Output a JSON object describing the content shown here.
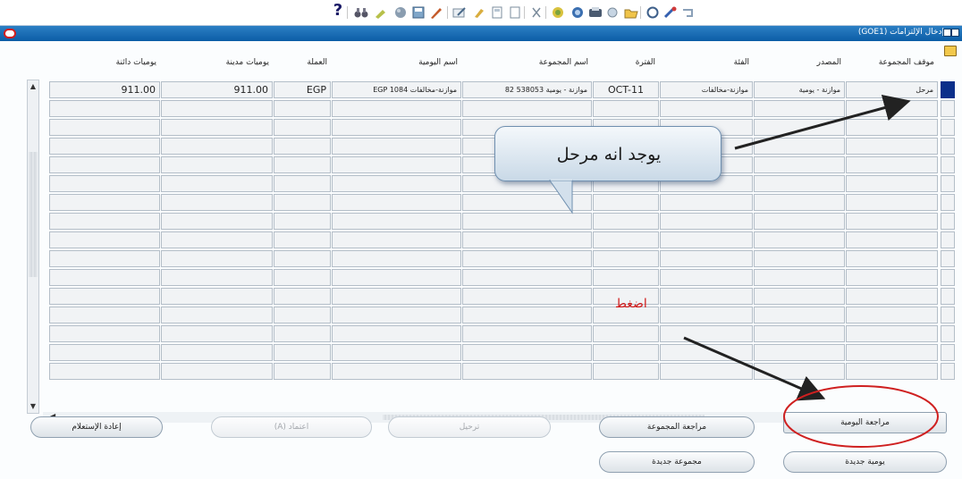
{
  "toolbar": {
    "help": "?",
    "icons": [
      "binoculars-icon",
      "flashlight-icon",
      "globe-icon",
      "save-icon",
      "pen-icon",
      "edit-icon",
      "attachment-icon",
      "book-icon",
      "document-icon",
      "cut-icon",
      "copy-icon",
      "paste-icon",
      "print-icon",
      "zoom-icon",
      "folder-open-icon",
      "clear-icon",
      "delete-icon",
      "refresh-icon"
    ]
  },
  "window": {
    "title": "إدخال الإلتزامات (GOE1)"
  },
  "table": {
    "headers": {
      "batch_status": "موقف المجموعة",
      "source": "المصدر",
      "category": "الفئة",
      "period": "الفترة",
      "batch_name": "اسم المجموعة",
      "journal_name": "اسم اليومية",
      "currency": "العملة",
      "entered_debits": "يوميات مدينة",
      "entered_credits": "يوميات دائنة"
    },
    "rows": [
      {
        "batch_status": "مرحل",
        "source": "موازنة - يومية",
        "category": "موازنة-مخالفات",
        "period": "OCT-11",
        "batch_name": "موازنة - يومية 538053 82",
        "journal_name": "موازنة-مخالفات EGP 1084",
        "currency": "EGP",
        "entered_debits": "911.00",
        "entered_credits": "911.00"
      }
    ],
    "empty_rows": 15
  },
  "buttons": {
    "review_journal": "مراجعة اليومية",
    "review_batch": "مراجعة المجموعة",
    "post": "ترحيل",
    "reverse": "اعتماد (A)",
    "requery": "إعادة الإستعلام",
    "new_journal": "يومية جديدة",
    "new_batch": "مجموعة جديدة"
  },
  "annotations": {
    "callout": "يوجد انه مرحل",
    "press": "اضغط"
  }
}
